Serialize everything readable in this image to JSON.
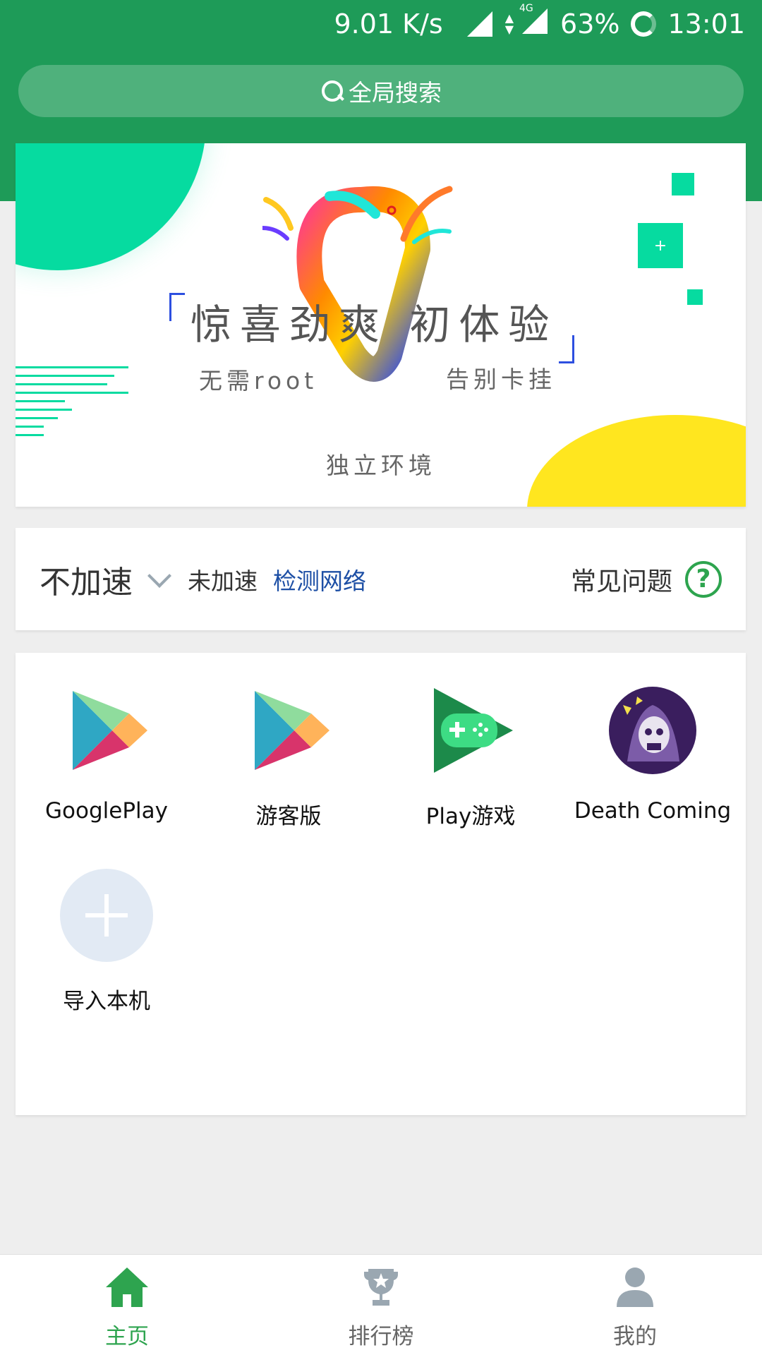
{
  "status_bar": {
    "net_speed": "9.01 K/s",
    "network_type": "4G",
    "battery": "63%",
    "time": "13:01"
  },
  "search": {
    "label": "全局搜索"
  },
  "banner": {
    "title": "惊喜劲爽  初体验",
    "sub_left": "无需root",
    "sub_right": "告别卡挂",
    "sub_bottom": "独立环境",
    "badge_plus": "+"
  },
  "accel": {
    "mode": "不加速",
    "status": "未加速",
    "detect": "检测网络",
    "faq": "常见问题",
    "help": "?"
  },
  "apps": [
    {
      "label": "GooglePlay",
      "icon": "google-play-icon"
    },
    {
      "label": "游客版",
      "icon": "google-play-icon"
    },
    {
      "label": "Play游戏",
      "icon": "play-games-icon"
    },
    {
      "label": "Death Coming",
      "icon": "death-coming-icon"
    },
    {
      "label": "导入本机",
      "icon": "add-icon"
    }
  ],
  "nav": {
    "items": [
      {
        "label": "主页",
        "icon": "home-icon",
        "active": true
      },
      {
        "label": "排行榜",
        "icon": "trophy-icon",
        "active": false
      },
      {
        "label": "我的",
        "icon": "person-icon",
        "active": false
      }
    ]
  },
  "colors": {
    "header_green": "#1e9b58",
    "accent_green": "#2ea44f",
    "mint": "#06dba0",
    "link_blue": "#1d4fa5",
    "nav_inactive": "#9aa7b1"
  }
}
